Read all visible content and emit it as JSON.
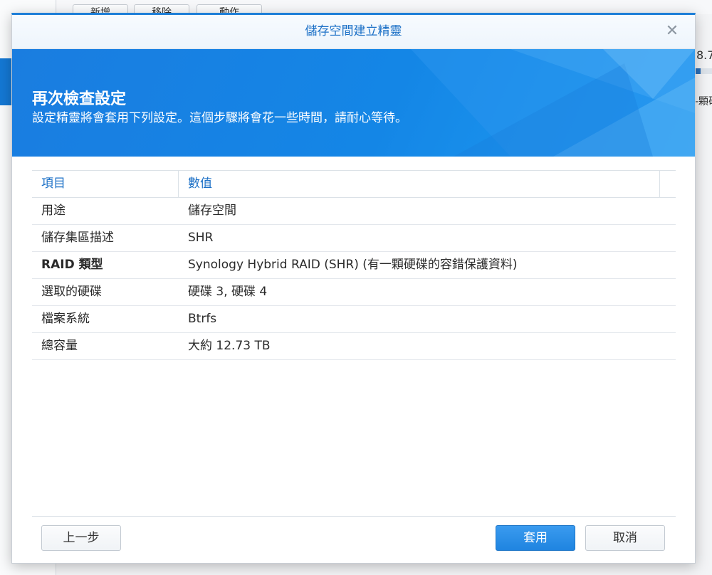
{
  "background": {
    "toolbar_buttons": [
      "新增",
      "移除",
      "動作"
    ],
    "right_value": "8.7",
    "right_text": "-顆碩"
  },
  "dialog": {
    "title": "儲存空間建立精靈",
    "close_label": "✕",
    "banner": {
      "heading": "再次檢查設定",
      "subtitle": "設定精靈將會套用下列設定。這個步驟將會花一些時間，請耐心等待。"
    },
    "table": {
      "headers": [
        "項目",
        "數值"
      ],
      "rows": [
        {
          "item": "用途",
          "value": "儲存空間"
        },
        {
          "item": "儲存集區描述",
          "value": "SHR"
        },
        {
          "item": "RAID 類型",
          "value": "Synology Hybrid RAID (SHR) (有一顆硬碟的容錯保護資料)"
        },
        {
          "item": "選取的硬碟",
          "value": "硬碟 3, 硬碟 4"
        },
        {
          "item": "檔案系統",
          "value": "Btrfs"
        },
        {
          "item": "總容量",
          "value": "大約 12.73 TB"
        }
      ]
    },
    "buttons": {
      "back": "上一步",
      "apply": "套用",
      "cancel": "取消"
    }
  },
  "colors": {
    "accent": "#1a6fc6",
    "banner": "#1486e6",
    "primary_button": "#2a8fe6"
  }
}
